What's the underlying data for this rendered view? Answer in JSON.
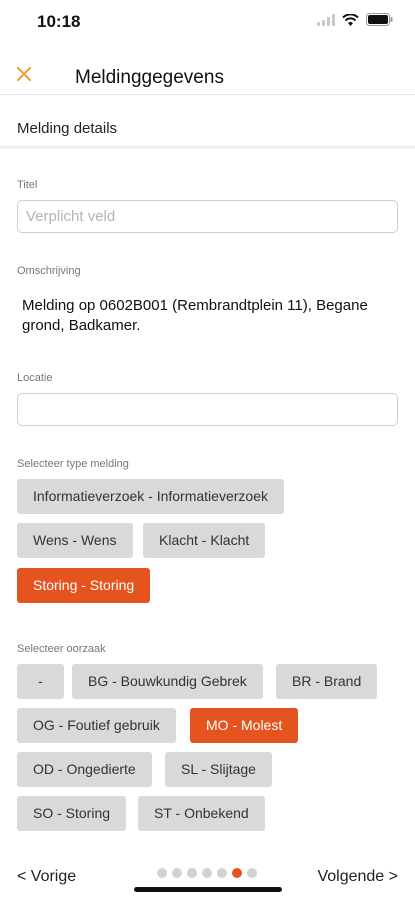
{
  "status_bar": {
    "time": "10:18"
  },
  "nav": {
    "title": "Meldinggegevens",
    "close_icon": "close-icon",
    "accent_color": "#e8a33a"
  },
  "section": {
    "title": "Melding details"
  },
  "form": {
    "title_label": "Titel",
    "title_placeholder": "Verplicht veld",
    "title_value": "",
    "description_label": "Omschrijving",
    "description_text": "Melding op 0602B001 (Rembrandtplein 11), Begane grond, Badkamer.",
    "location_label": "Locatie",
    "location_value": ""
  },
  "type_section": {
    "label": "Selecteer type melding",
    "options": [
      {
        "label": "Informatieverzoek - Informatieverzoek",
        "selected": false
      },
      {
        "label": "Wens - Wens",
        "selected": false
      },
      {
        "label": "Klacht - Klacht",
        "selected": false
      },
      {
        "label": "Storing - Storing",
        "selected": true
      }
    ]
  },
  "cause_section": {
    "label": "Selecteer oorzaak",
    "options": [
      {
        "label": "-",
        "selected": false
      },
      {
        "label": "BG - Bouwkundig Gebrek",
        "selected": false
      },
      {
        "label": "BR - Brand",
        "selected": false
      },
      {
        "label": "OG - Foutief gebruik",
        "selected": false
      },
      {
        "label": "MO - Molest",
        "selected": true
      },
      {
        "label": "OD - Ongedierte",
        "selected": false
      },
      {
        "label": "SL - Slijtage",
        "selected": false
      },
      {
        "label": "SO - Storing",
        "selected": false
      },
      {
        "label": "ST - Onbekend",
        "selected": false
      }
    ]
  },
  "footer": {
    "prev_label": "< Vorige",
    "next_label": "Volgende >",
    "pages_total": 7,
    "current_page": 6
  },
  "colors": {
    "selected_chip": "#e5531f",
    "chip": "#d9d9d9"
  }
}
